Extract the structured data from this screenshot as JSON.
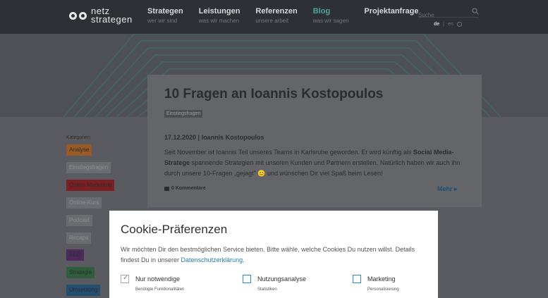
{
  "header": {
    "logo_line1": "netz",
    "logo_line2": "strategen",
    "nav": [
      {
        "title": "Strategen",
        "sub": "wer wir sind"
      },
      {
        "title": "Leistungen",
        "sub": "was wir machen"
      },
      {
        "title": "Referenzen",
        "sub": "unsere arbeit"
      },
      {
        "title": "Blog",
        "sub": "was wir sagen"
      },
      {
        "title": "Projektanfrage",
        "sub": ""
      }
    ],
    "search_placeholder": "Suche",
    "lang_de": "de",
    "lang_sep": "|",
    "lang_en": "en"
  },
  "article": {
    "title": "10 Fragen an Ioannis Kostopoulos",
    "tag": "Einstiegsfragen",
    "meta": "17.12.2020 | Ioannis Kostopoulos",
    "body_1": "Seit November ist Ioannis Teil unseres Teams in Karlsruhe geworden. Er wird künftig als ",
    "body_bold": "Social Media-Stratege",
    "body_2": " spannende Strategien mit unseren Kunden und Partnern erstellen. Natürlich haben wir auch ihn durch unsere 10-Fragen „gejagt\" 😊 und wünschen Dir viel Spaß beim Lesen!",
    "comments": "0 Kommentare",
    "more": "Mehr ▸"
  },
  "categories": {
    "title": "Kategorien",
    "items": [
      {
        "label": "Analyse",
        "color": "#9a5a26"
      },
      {
        "label": "Einstiegsfragen",
        "color": "#6a6c70"
      },
      {
        "label": "Online Marketing",
        "color": "#7c1f22"
      },
      {
        "label": "Online-Kurs",
        "color": "#6a6c70"
      },
      {
        "label": "Podcast",
        "color": "#6a6c70"
      },
      {
        "label": "Recaps",
        "color": "#6a6c70"
      },
      {
        "label": "SEO",
        "color": "#4e2a5c"
      },
      {
        "label": "Strategie",
        "color": "#2f5e3c"
      },
      {
        "label": "Umsetzung",
        "color": "#234e6e"
      }
    ]
  },
  "cookie": {
    "title": "Cookie-Präferenzen",
    "desc_1": "Wir möchten Dir den bestmöglichen Service bieten. Bitte wähle, welche Cookies Du nutzen willst. Details findest Du in unserer ",
    "desc_link": "Datenschutzerklärung",
    "desc_2": ".",
    "options": [
      {
        "label": "Nur notwendige",
        "sub": "Benötigte Funktionalitäten",
        "checked": true
      },
      {
        "label": "Nutzungsanalyse",
        "sub": "Statistiken",
        "checked": false
      },
      {
        "label": "Marketing",
        "sub": "Personalisierung",
        "checked": false
      }
    ]
  },
  "colors": {
    "accent": "#4aa69c",
    "link": "#2a7bb0"
  }
}
